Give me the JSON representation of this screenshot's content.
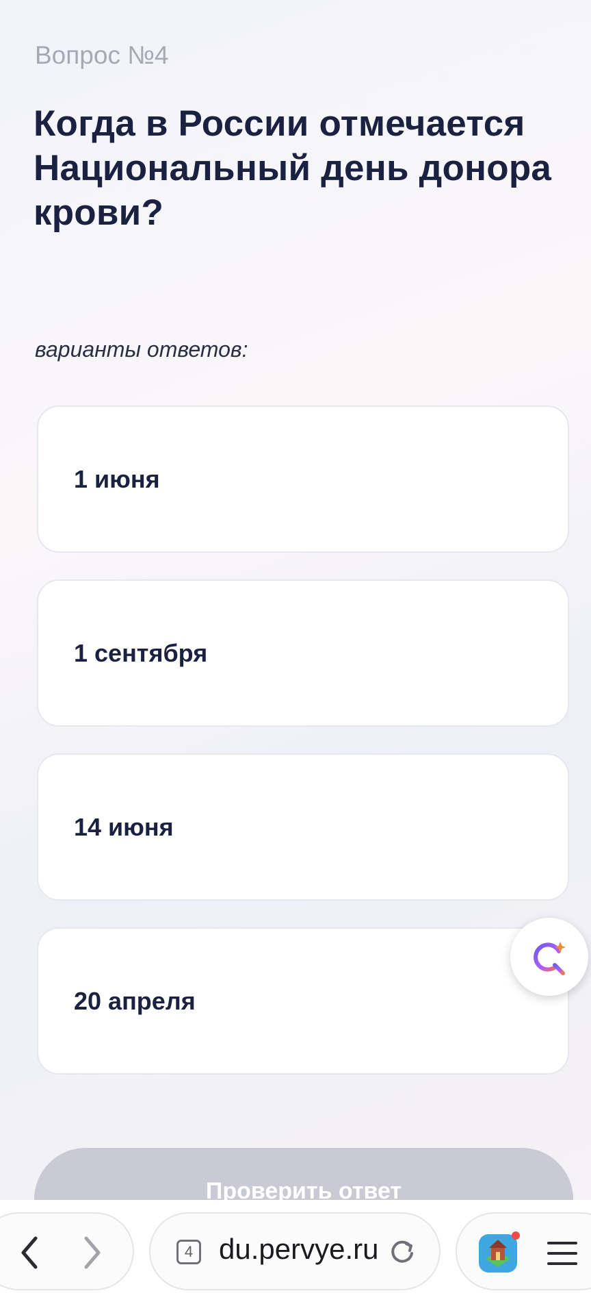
{
  "question": {
    "number_label": "Вопрос №4",
    "title": "Когда в России отмечается Национальный день донора крови?"
  },
  "answers_label": "варианты ответов:",
  "answers": [
    {
      "label": "1 июня"
    },
    {
      "label": "1 сентября"
    },
    {
      "label": "14 июня"
    },
    {
      "label": "20 апреля"
    }
  ],
  "check_button": "Проверить ответ",
  "browser": {
    "url": "du.pervye.ru",
    "tab_count": "4"
  },
  "icons": {
    "fab": "assistant-icon",
    "back": "chevron-left-icon",
    "forward": "chevron-right-icon",
    "reload": "reload-icon",
    "extension": "game-app-icon",
    "menu": "menu-icon"
  },
  "colors": {
    "title": "#1b2140",
    "button_disabled": "#c9cad4",
    "notification_dot": "#f04a4a"
  }
}
